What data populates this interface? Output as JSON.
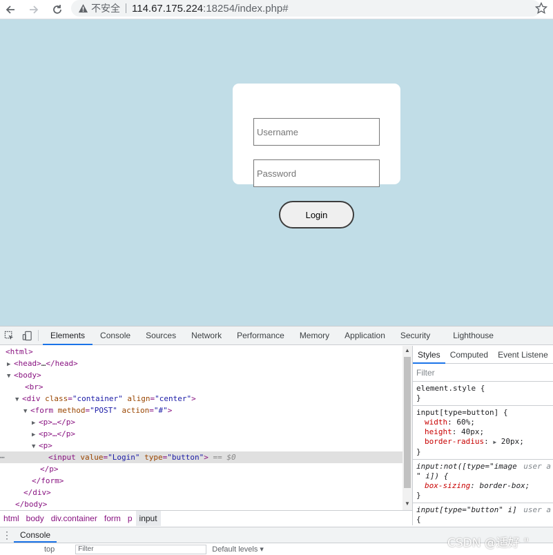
{
  "browser": {
    "security_label": "不安全",
    "url_host": "114.67.175.224",
    "url_rest": ":18254/index.php#"
  },
  "page": {
    "username_placeholder": "Username",
    "password_placeholder": "Password",
    "login_label": "Login",
    "background_color": "#c1dde7"
  },
  "devtools": {
    "tabs": [
      "Elements",
      "Console",
      "Sources",
      "Network",
      "Performance",
      "Memory",
      "Application",
      "Security",
      "Lighthouse"
    ],
    "active_tab": "Elements",
    "dom": {
      "l1": "<html>",
      "l2_open": "<head>",
      "l2_ellipsis": "…",
      "l2_close": "</head>",
      "l3": "<body>",
      "l4": "<br>",
      "l5_tag": "<div",
      "l5_attr1": "class",
      "l5_val1": "\"container\"",
      "l5_attr2": "align",
      "l5_val2": "\"center\"",
      "l6_tag": "<form",
      "l6_attr1": "method",
      "l6_val1": "\"POST\"",
      "l6_attr2": "action",
      "l6_val2": "\"#\"",
      "l7": "<p>…</p>",
      "l8": "<p>…</p>",
      "l9": "<p>",
      "l10_tag": "<input",
      "l10_attr1": "value",
      "l10_val1": "\"Login\"",
      "l10_attr2": "type",
      "l10_val2": "\"button\"",
      "l10_eq": "== $0",
      "l11": "</p>",
      "l12": "</form>",
      "l13": "</div>",
      "l14": "</body>"
    },
    "breadcrumbs": [
      "html",
      "body",
      "div.container",
      "form",
      "p",
      "input"
    ],
    "styles_tabs": [
      "Styles",
      "Computed",
      "Event Listene"
    ],
    "filter_placeholder": "Filter",
    "rules": {
      "r1_sel": "element.style {",
      "r1_close": "}",
      "r2_sel": "input[type=button] {",
      "r2_p1": "width",
      "r2_v1": "60%;",
      "r2_p2": "height",
      "r2_v2": "40px;",
      "r2_p3": "border-radius",
      "r2_v3": "20px;",
      "r2_close": "}",
      "r3_sel_a": "input:not([type=\"image",
      "r3_sel_b": "\" i]) {",
      "r3_ua": "user a",
      "r3_p1": "box-sizing",
      "r3_v1": "border-box;",
      "r3_close": "}",
      "r4_sel": "input[type=\"button\" i]",
      "r4_ua": "user a",
      "r4_open": "{"
    },
    "drawer_tab": "Console",
    "context": "top",
    "drawer_filter": "Filter",
    "levels": "Default levels ▾"
  },
  "watermark": "CSDN @适好   \""
}
